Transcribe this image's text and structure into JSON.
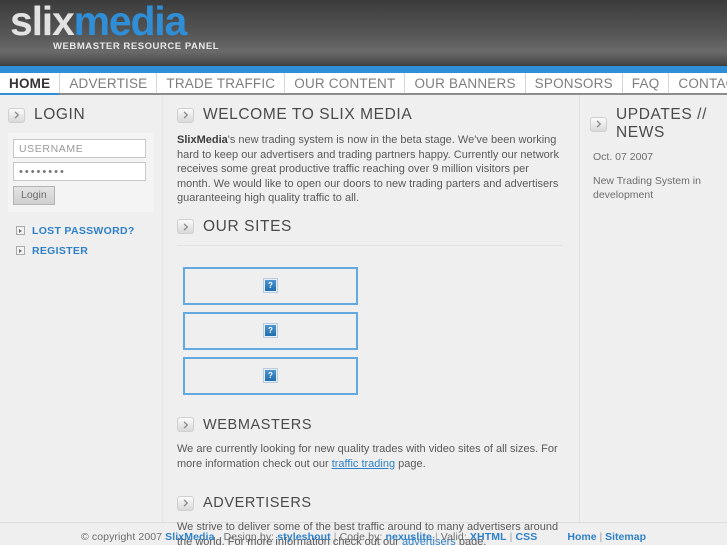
{
  "header": {
    "logo_first": "slix",
    "logo_second": "media",
    "tagline": "WEBMASTER RESOURCE PANEL",
    "accent_color": "#2f8ed6"
  },
  "nav": {
    "items": [
      {
        "label": "HOME",
        "active": true
      },
      {
        "label": "ADVERTISE",
        "active": false
      },
      {
        "label": "TRADE TRAFFIC",
        "active": false
      },
      {
        "label": "OUR CONTENT",
        "active": false
      },
      {
        "label": "OUR BANNERS",
        "active": false
      },
      {
        "label": "SPONSORS",
        "active": false
      },
      {
        "label": "FAQ",
        "active": false
      },
      {
        "label": "CONTACT US",
        "active": false
      }
    ]
  },
  "sidebar": {
    "login_title": "LOGIN",
    "username_value": "USERNAME",
    "password_value": "••••••••",
    "login_button": "Login",
    "links": [
      {
        "label": "LOST PASSWORD?"
      },
      {
        "label": "REGISTER"
      }
    ]
  },
  "main": {
    "welcome_title": "WELCOME TO SLIX MEDIA",
    "welcome_lead": "SlixMedia",
    "welcome_body": "'s new trading system is now in the beta stage. We've been working hard to keep our advertisers and trading partners happy. Currently our network receives some great productive traffic reaching over 9 million visitors per month. We would like to open our doors to new trading parters and advertisers guaranteeing high quality traffic to all.",
    "sites_title": "OUR SITES",
    "sites": [
      {
        "alt": "broken-image",
        "glyph": "?"
      },
      {
        "alt": "broken-image",
        "glyph": "?"
      },
      {
        "alt": "broken-image",
        "glyph": "?"
      }
    ],
    "webmasters_title": "WEBMASTERS",
    "webmasters_body_1": "We are currently looking for new quality trades with video sites of all sizes. For more information check out our ",
    "webmasters_link": "traffic trading",
    "webmasters_body_2": " page.",
    "advertisers_title": "ADVERTISERS",
    "advertisers_body_1": "We strive to deliver some of the best traffic around to many advertisers around the world. For more information check out our ",
    "advertisers_link": "advertisers",
    "advertisers_body_2": " page."
  },
  "news": {
    "title": "UPDATES // NEWS",
    "date": "Oct. 07 2007",
    "text": "New Trading System in development"
  },
  "footer": {
    "copyright": "© copyright 2007",
    "brand": "SlixMedia",
    "design_label": "Design by:",
    "design_link": "styleshout",
    "code_label": "Code by:",
    "code_link": "nexuslite",
    "valid_label": "Valid:",
    "valid_xhtml": "XHTML",
    "valid_css": "CSS",
    "home": "Home",
    "sitemap": "Sitemap",
    "sep": "|"
  }
}
